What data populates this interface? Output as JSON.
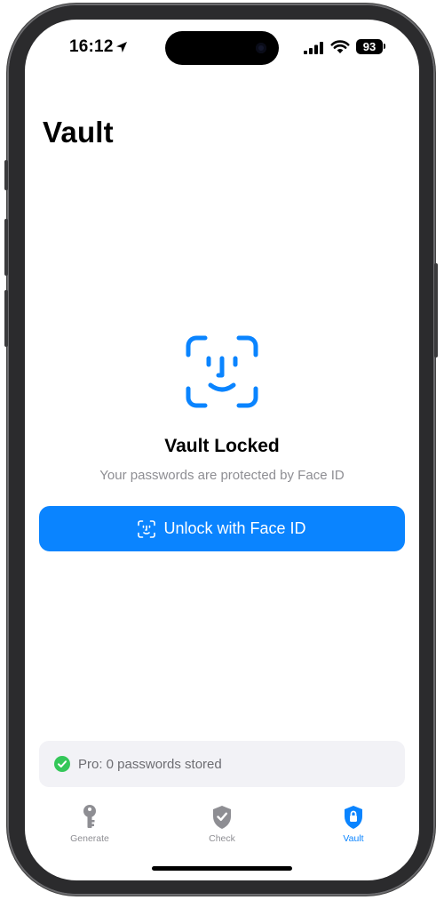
{
  "status_bar": {
    "time": "16:12",
    "battery_level": "93",
    "icons": [
      "location-arrow-icon",
      "cellular-signal-icon",
      "wifi-icon",
      "battery-icon"
    ]
  },
  "page": {
    "title": "Vault"
  },
  "locked_state": {
    "icon": "face-id-icon",
    "title": "Vault Locked",
    "subtitle": "Your passwords are protected by Face ID",
    "unlock_button_label": "Unlock with Face ID"
  },
  "pro_status": {
    "icon": "checkmark-circle-icon",
    "label": "Pro: 0 passwords stored"
  },
  "tab_bar": {
    "tabs": [
      {
        "label": "Generate",
        "icon": "key-icon",
        "active": false
      },
      {
        "label": "Check",
        "icon": "shield-check-icon",
        "active": false
      },
      {
        "label": "Vault",
        "icon": "lock-shield-icon",
        "active": true
      }
    ]
  },
  "colors": {
    "accent": "#0a84ff",
    "success": "#34c759",
    "inactive": "#8e8e93",
    "card_background": "#f2f2f6"
  }
}
